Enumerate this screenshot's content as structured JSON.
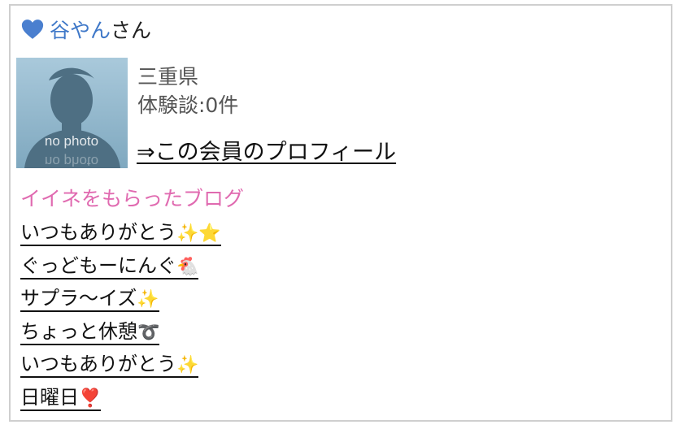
{
  "member": {
    "name": "谷やん",
    "honorific": "さん",
    "prefecture": "三重県",
    "experience_count": "体験談:0件",
    "profile_link": "⇒この会員のプロフィール",
    "avatar_caption": "no photo"
  },
  "blog_section": {
    "title": "イイネをもらったブログ",
    "items": [
      {
        "title": "いつもありがとう",
        "emoji": "✨⭐"
      },
      {
        "title": "ぐっどもーにんぐ",
        "emoji": "🐔"
      },
      {
        "title": "サプラ〜イズ",
        "emoji": "✨"
      },
      {
        "title": "ちょっと休憩",
        "emoji": "➰"
      },
      {
        "title": "いつもありがとう",
        "emoji": "✨"
      },
      {
        "title": "日曜日",
        "emoji": "❣️"
      }
    ]
  },
  "colors": {
    "heart": "#4a7fcf",
    "name": "#3f78c8",
    "section_title": "#e06ab0",
    "border": "#cfcfcf"
  },
  "icons": {
    "heart": "blue-heart-icon",
    "avatar": "no-photo-silhouette"
  }
}
